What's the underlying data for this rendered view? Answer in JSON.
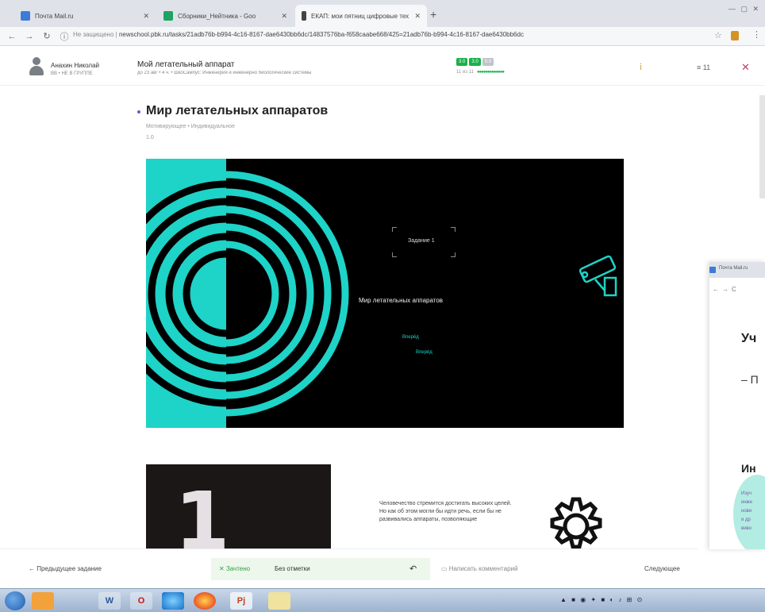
{
  "browser": {
    "tabs": [
      {
        "title": "Почта Mail.ru",
        "icon_color": "#3c7bd8"
      },
      {
        "title": "Сборники_Нейтника - Goo",
        "icon_color": "#1ea362"
      },
      {
        "title": "ЕКАП: мои пятниц цифровые тех",
        "icon_color": "#444444"
      }
    ],
    "url_prefix": "Не защищено",
    "url": "newschool.pbk.ru/tasks/21adb76b-b994-4c16-8167-dae6430bb6dc/14837576ba-f658caabe668/425=21adb76b-b994-4c16-8167-dae6430bb6dc"
  },
  "task": {
    "user_name": "Анахин Николай",
    "user_role": "ВВ • НЕ В ГРУППЕ",
    "title": "Мой летательный аппарат",
    "meta": "до 23 авг • 4 ч. • ШкоСампус: Инженерия и инженерно биологические системы",
    "scores": [
      {
        "label": "3.0",
        "color": "#19b14a"
      },
      {
        "label": "3.0",
        "color": "#19b14a"
      },
      {
        "label": "0.0",
        "color": "#bfc4c9"
      }
    ],
    "progress_text": "11 из 11",
    "progress_dots": "●●●●●●●●●●●●●",
    "list_count": "11"
  },
  "content": {
    "title": "Мир летательных аппаратов",
    "subtitle": "Мотивирующее • Индивидуальное",
    "version": "1.0",
    "slide1": {
      "tag": "Задание 1",
      "heading": "Мир летательных аппаратов",
      "line1": "Вперёд",
      "line2": "Вперёд"
    },
    "slide2": {
      "digit": "1",
      "paragraph": "Человечество стремится достигать высоких целей. Но как об этом могли бы идти речь, если бы не развивались аппараты, позволяющие"
    }
  },
  "footer": {
    "prev": "Предыдущее задание",
    "status_check": "Зачтено",
    "status_mark": "Без отметки",
    "comment": "Написать комментарий",
    "next": "Следующее"
  },
  "side_window": {
    "tab": "Почта Mail.ru",
    "heading": "Уч",
    "dash": "– П",
    "heading2": "Ин",
    "lines": [
      "Изуч",
      "инже",
      "нови",
      "и др",
      "виво"
    ]
  },
  "taskbar": {
    "items": [
      "W",
      "O",
      "Pj"
    ]
  }
}
